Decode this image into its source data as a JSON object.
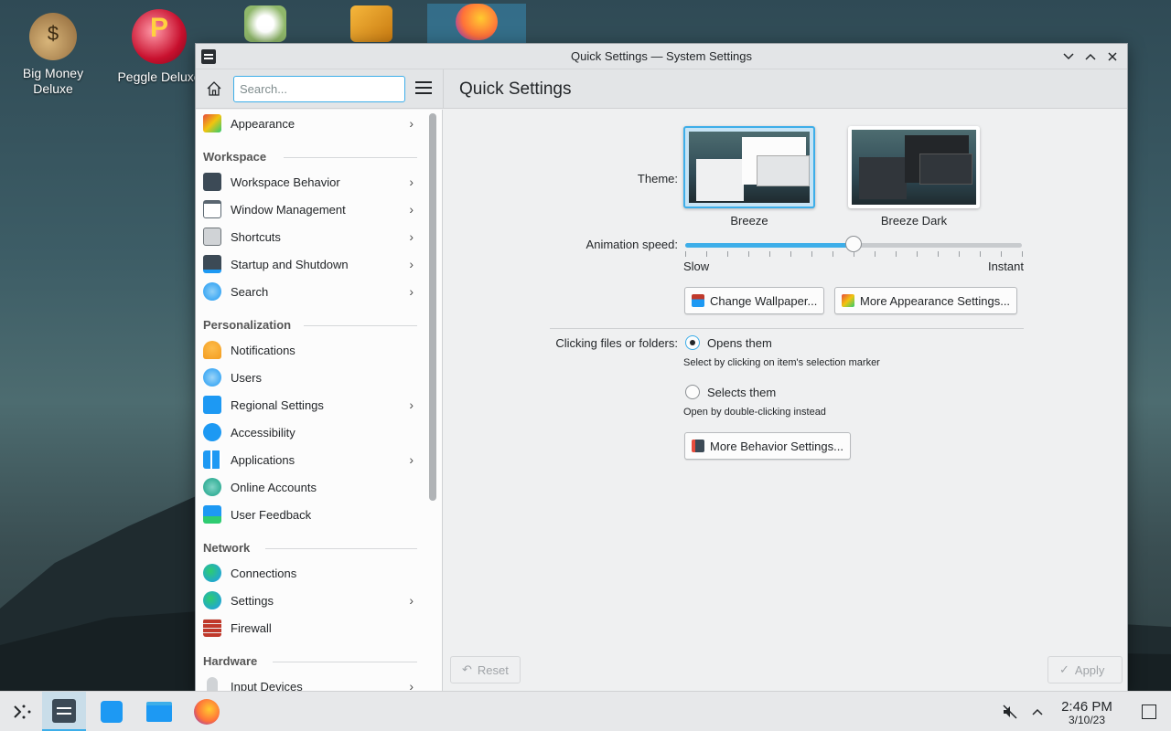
{
  "desktop": {
    "icons": [
      {
        "label": "Big Money Deluxe"
      },
      {
        "label": "Peggle Deluxe"
      }
    ]
  },
  "window": {
    "title": "Quick Settings — System Settings",
    "search_placeholder": "Search...",
    "page_title": "Quick Settings"
  },
  "sidebar": {
    "top_item": {
      "label": "Appearance"
    },
    "sections": [
      {
        "label": "Workspace",
        "items": [
          "Workspace Behavior",
          "Window Management",
          "Shortcuts",
          "Startup and Shutdown",
          "Search"
        ]
      },
      {
        "label": "Personalization",
        "items": [
          "Notifications",
          "Users",
          "Regional Settings",
          "Accessibility",
          "Applications",
          "Online Accounts",
          "User Feedback"
        ]
      },
      {
        "label": "Network",
        "items": [
          "Connections",
          "Settings",
          "Firewall"
        ]
      },
      {
        "label": "Hardware",
        "items": [
          "Input Devices"
        ]
      }
    ]
  },
  "content": {
    "theme_label": "Theme:",
    "themes": [
      {
        "name": "Breeze",
        "selected": true
      },
      {
        "name": "Breeze Dark",
        "selected": false
      }
    ],
    "animation_label": "Animation speed:",
    "animation_value": 0.5,
    "slow_label": "Slow",
    "instant_label": "Instant",
    "change_wallpaper": "Change Wallpaper...",
    "more_appearance": "More Appearance Settings...",
    "clicking_label": "Clicking files or folders:",
    "opens_label": "Opens them",
    "opens_hint": "Select by clicking on item's selection marker",
    "selects_label": "Selects them",
    "selects_hint": "Open by double-clicking instead",
    "more_behavior": "More Behavior Settings...",
    "reset": "Reset",
    "apply": "Apply"
  },
  "taskbar": {
    "time": "2:46 PM",
    "date": "3/10/23"
  }
}
